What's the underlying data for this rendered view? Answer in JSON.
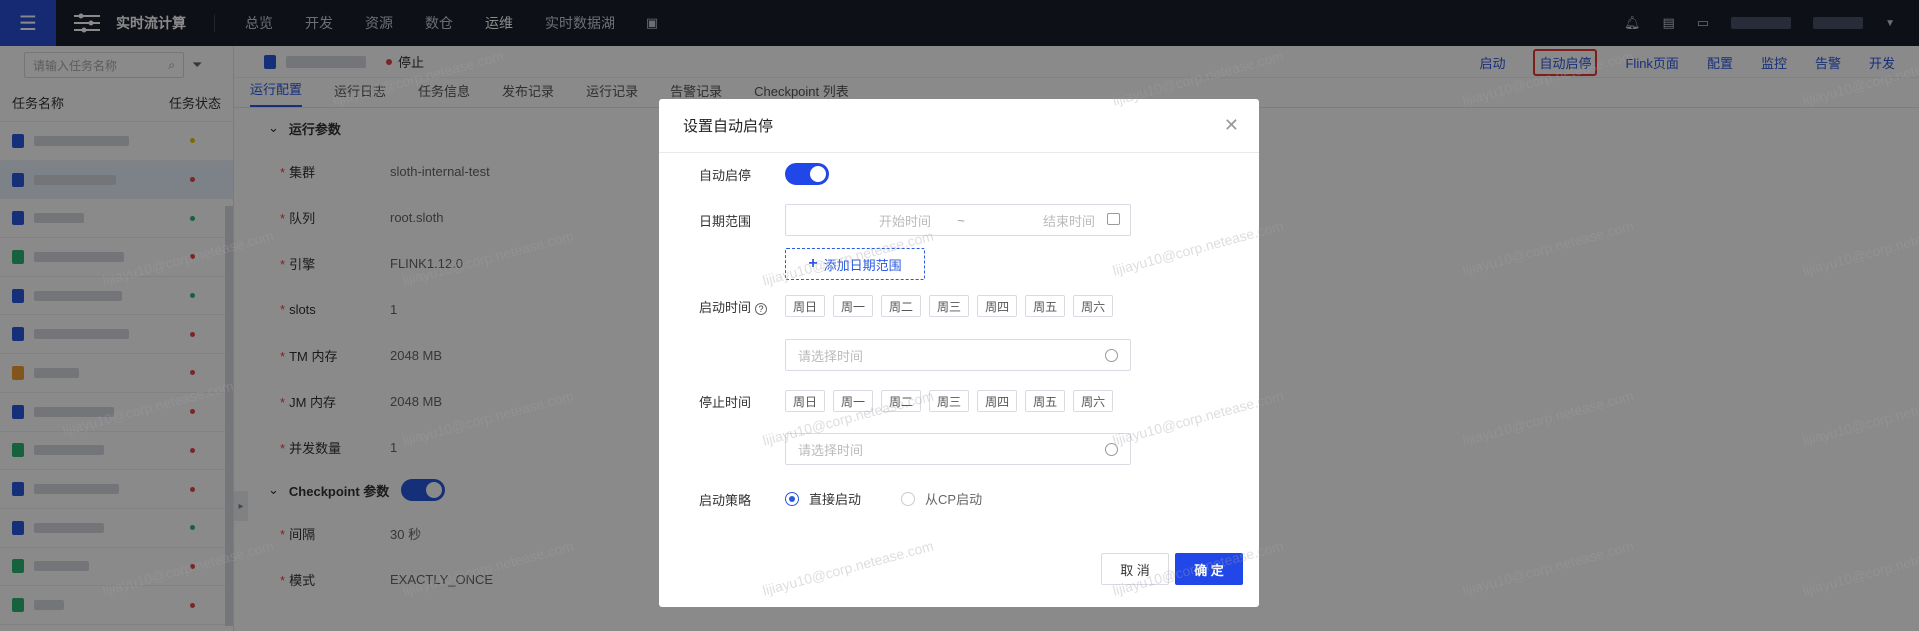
{
  "nav": {
    "brand": "实时流计算",
    "items": [
      "总览",
      "开发",
      "资源",
      "数仓",
      "运维",
      "实时数据湖"
    ],
    "active": "运维"
  },
  "sidebar": {
    "search_placeholder": "请输入任务名称",
    "col_name": "任务名称",
    "col_status": "任务状态",
    "rows": [
      {
        "icon_color": "#2a58e0",
        "status_color": "#e6c400",
        "name_width": 95
      },
      {
        "icon_color": "#2a58e0",
        "status_color": "#e54545",
        "name_width": 82,
        "selected": true
      },
      {
        "icon_color": "#2a58e0",
        "status_color": "#2bb673",
        "name_width": 50
      },
      {
        "icon_color": "#2bb673",
        "status_color": "#e54545",
        "name_width": 90
      },
      {
        "icon_color": "#2a58e0",
        "status_color": "#2bb673",
        "name_width": 88
      },
      {
        "icon_color": "#2a58e0",
        "status_color": "#e54545",
        "name_width": 95
      },
      {
        "icon_color": "#f0a030",
        "status_color": "#e54545",
        "name_width": 45
      },
      {
        "icon_color": "#2a58e0",
        "status_color": "#e54545",
        "name_width": 80
      },
      {
        "icon_color": "#2bb673",
        "status_color": "#e54545",
        "name_width": 70
      },
      {
        "icon_color": "#2a58e0",
        "status_color": "#e54545",
        "name_width": 85
      },
      {
        "icon_color": "#2a58e0",
        "status_color": "#2bb673",
        "name_width": 70
      },
      {
        "icon_color": "#2bb673",
        "status_color": "#e54545",
        "name_width": 55
      },
      {
        "icon_color": "#2bb673",
        "status_color": "#e54545",
        "name_width": 30
      }
    ]
  },
  "header": {
    "status": "停止",
    "actions": [
      "启动",
      "自动启停",
      "Flink页面",
      "配置",
      "监控",
      "告警",
      "开发"
    ],
    "highlighted_action": "自动启停"
  },
  "tabs": [
    "运行配置",
    "运行日志",
    "任务信息",
    "发布记录",
    "运行记录",
    "告警记录",
    "Checkpoint 列表"
  ],
  "section_run": {
    "title": "运行参数",
    "params": [
      {
        "label": "集群",
        "value": "sloth-internal-test"
      },
      {
        "label": "队列",
        "value": "root.sloth"
      },
      {
        "label": "引擎",
        "value": "FLINK1.12.0"
      },
      {
        "label": "slots",
        "value": "1"
      },
      {
        "label": "TM 内存",
        "value": "2048 MB"
      },
      {
        "label": "JM 内存",
        "value": "2048 MB"
      },
      {
        "label": "并发数量",
        "value": "1"
      }
    ]
  },
  "section_cp": {
    "title": "Checkpoint 参数",
    "params": [
      {
        "label": "间隔",
        "value": "30 秒"
      },
      {
        "label": "模式",
        "value": "EXACTLY_ONCE"
      }
    ]
  },
  "modal": {
    "title": "设置自动启停",
    "auto_label": "自动启停",
    "date_label": "日期范围",
    "start_placeholder": "开始时间",
    "tilde": "~",
    "end_placeholder": "结束时间",
    "add_range": "添加日期范围",
    "start_time_label": "启动时间",
    "stop_time_label": "停止时间",
    "days": [
      "周日",
      "周一",
      "周二",
      "周三",
      "周四",
      "周五",
      "周六"
    ],
    "time_placeholder": "请选择时间",
    "strategy_label": "启动策略",
    "strategy_options": [
      "直接启动",
      "从CP启动"
    ],
    "cancel": "取 消",
    "ok": "确 定"
  },
  "watermark": "lijiayu10@corp.netease.com",
  "colors": {
    "accent": "#2147e8",
    "topbar": "#1b1f2e",
    "danger": "#e53935"
  }
}
